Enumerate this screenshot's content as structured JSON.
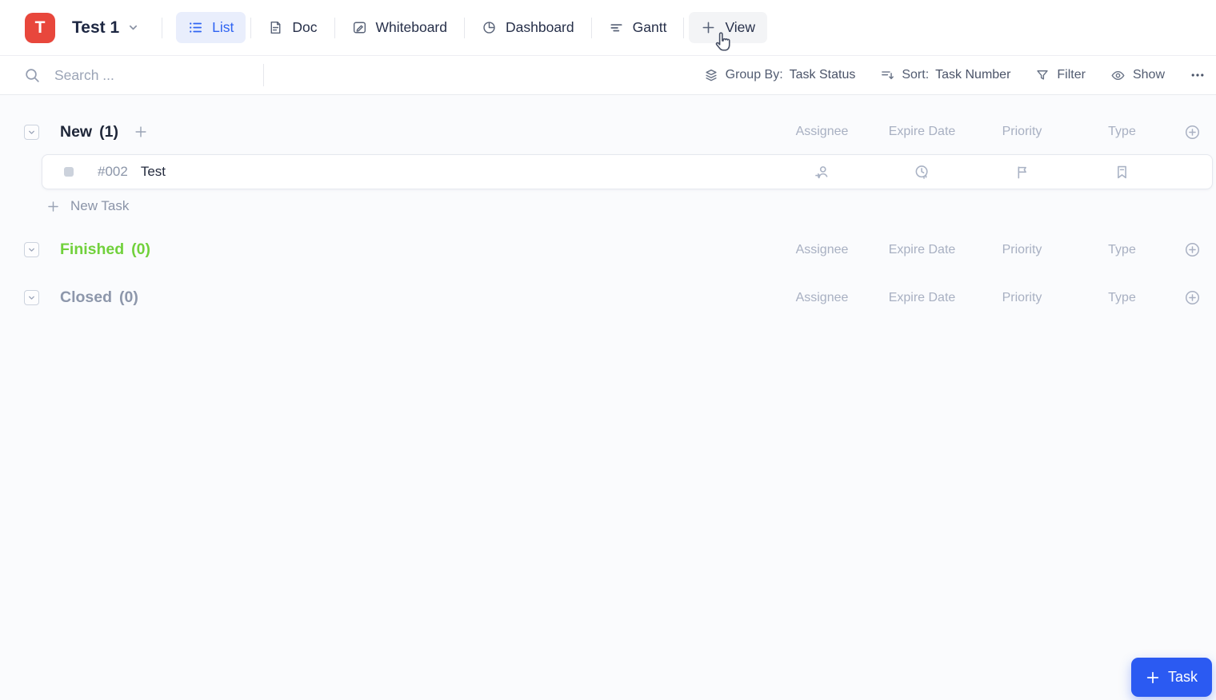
{
  "topbar": {
    "logo_letter": "T",
    "project_name": "Test 1",
    "tabs": [
      {
        "label": "List",
        "icon": "list-icon",
        "state": "active"
      },
      {
        "label": "Doc",
        "icon": "doc-icon",
        "state": "normal"
      },
      {
        "label": "Whiteboard",
        "icon": "whiteboard-icon",
        "state": "normal"
      },
      {
        "label": "Dashboard",
        "icon": "dashboard-icon",
        "state": "normal"
      },
      {
        "label": "Gantt",
        "icon": "gantt-icon",
        "state": "normal"
      },
      {
        "label": "View",
        "icon": "plus-icon",
        "state": "hovered"
      }
    ]
  },
  "toolbar": {
    "search": {
      "icon": "search-icon",
      "placeholder": "Search ...",
      "value": ""
    },
    "group_by": {
      "icon": "layers-icon",
      "label": "Group By:",
      "value": "Task Status"
    },
    "sort": {
      "icon": "sort-icon",
      "label": "Sort:",
      "value": "Task Number"
    },
    "filter": {
      "icon": "filter-icon",
      "label": "Filter"
    },
    "show": {
      "icon": "eye-icon",
      "label": "Show"
    },
    "more": {
      "icon": "ellipsis-icon"
    }
  },
  "list": {
    "columns": [
      "Assignee",
      "Expire Date",
      "Priority",
      "Type"
    ],
    "groups": [
      {
        "name": "New",
        "count": "(1)",
        "status_color": "#1e2638"
      },
      {
        "name": "Finished",
        "count": "(0)",
        "status_color": "#71d13c"
      },
      {
        "name": "Closed",
        "count": "(0)",
        "status_color": "#8d97ab"
      }
    ],
    "task": {
      "id": "#002",
      "title": "Test",
      "row_icons": [
        "assignee-icon",
        "expire-date-icon",
        "priority-flag-icon",
        "type-bookmark-icon"
      ]
    },
    "new_task_label": "New Task"
  },
  "fab": {
    "label": "Task"
  },
  "colors": {
    "logo_red": "#e8473c",
    "active_tab_blue": "#2e63f2",
    "finished_green": "#71d13c",
    "closed_gray": "#8d97ab",
    "accent_blue": "#2b5af2"
  }
}
